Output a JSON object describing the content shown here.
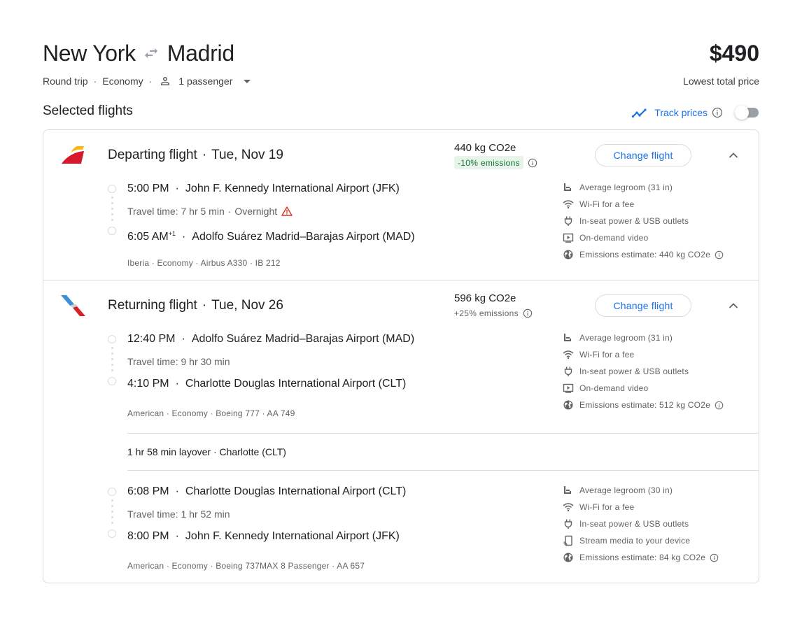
{
  "header": {
    "origin": "New York",
    "destination": "Madrid",
    "trip_type": "Round trip",
    "cabin": "Economy",
    "passengers": "1 passenger",
    "price": "$490",
    "price_label": "Lowest total price"
  },
  "section_title": "Selected flights",
  "track_prices": {
    "label": "Track prices",
    "enabled": false
  },
  "departing": {
    "title": "Departing flight",
    "date": "Tue, Nov 19",
    "emissions": "440 kg CO2e",
    "emissions_badge": "-10% emissions",
    "change_label": "Change flight",
    "leg": {
      "dep_time": "5:00 PM",
      "dep_airport": "John F. Kennedy International Airport (JFK)",
      "travel_time": "Travel time: 7 hr 5 min",
      "travel_note": "Overnight",
      "arr_time": "6:05 AM",
      "arr_day_offset": "+1",
      "arr_airport": "Adolfo Suárez Madrid–Barajas Airport (MAD)",
      "details": "Iberia · Economy · Airbus A330 · IB 212",
      "amenities": [
        {
          "icon": "legroom-icon",
          "text": "Average legroom (31 in)"
        },
        {
          "icon": "wifi-icon",
          "text": "Wi-Fi for a fee"
        },
        {
          "icon": "power-plug-icon",
          "text": "In-seat power & USB outlets"
        },
        {
          "icon": "video-icon",
          "text": "On-demand video"
        },
        {
          "icon": "globe-icon",
          "text": "Emissions estimate: 440 kg CO2e"
        }
      ]
    }
  },
  "returning": {
    "title": "Returning flight",
    "date": "Tue, Nov 26",
    "emissions": "596 kg CO2e",
    "emissions_badge": "+25% emissions",
    "change_label": "Change flight",
    "legs": [
      {
        "dep_time": "12:40 PM",
        "dep_airport": "Adolfo Suárez Madrid–Barajas Airport (MAD)",
        "travel_time": "Travel time: 9 hr 30 min",
        "arr_time": "4:10 PM",
        "arr_airport": "Charlotte Douglas International Airport (CLT)",
        "details": "American · Economy · Boeing 777 · AA 749",
        "amenities": [
          {
            "icon": "legroom-icon",
            "text": "Average legroom (31 in)"
          },
          {
            "icon": "wifi-icon",
            "text": "Wi-Fi for a fee"
          },
          {
            "icon": "power-plug-icon",
            "text": "In-seat power & USB outlets"
          },
          {
            "icon": "video-icon",
            "text": "On-demand video"
          },
          {
            "icon": "globe-icon",
            "text": "Emissions estimate: 512 kg CO2e"
          }
        ]
      },
      {
        "dep_time": "6:08 PM",
        "dep_airport": "Charlotte Douglas International Airport (CLT)",
        "travel_time": "Travel time: 1 hr 52 min",
        "arr_time": "8:00 PM",
        "arr_airport": "John F. Kennedy International Airport (JFK)",
        "details": "American · Economy · Boeing 737MAX 8 Passenger · AA 657",
        "amenities": [
          {
            "icon": "legroom-icon",
            "text": "Average legroom (30 in)"
          },
          {
            "icon": "wifi-icon",
            "text": "Wi-Fi for a fee"
          },
          {
            "icon": "power-plug-icon",
            "text": "In-seat power & USB outlets"
          },
          {
            "icon": "stream-icon",
            "text": "Stream media to your device"
          },
          {
            "icon": "globe-icon",
            "text": "Emissions estimate: 84 kg CO2e"
          }
        ]
      }
    ],
    "layover": "1 hr 58 min layover · Charlotte (CLT)"
  },
  "colors": {
    "accent": "#1a73e8",
    "text": "#202124",
    "muted": "#5f6368",
    "border": "#dadce0",
    "emission_good_bg": "#e6f4ea",
    "emission_good_text": "#137333",
    "warning": "#d93025"
  }
}
